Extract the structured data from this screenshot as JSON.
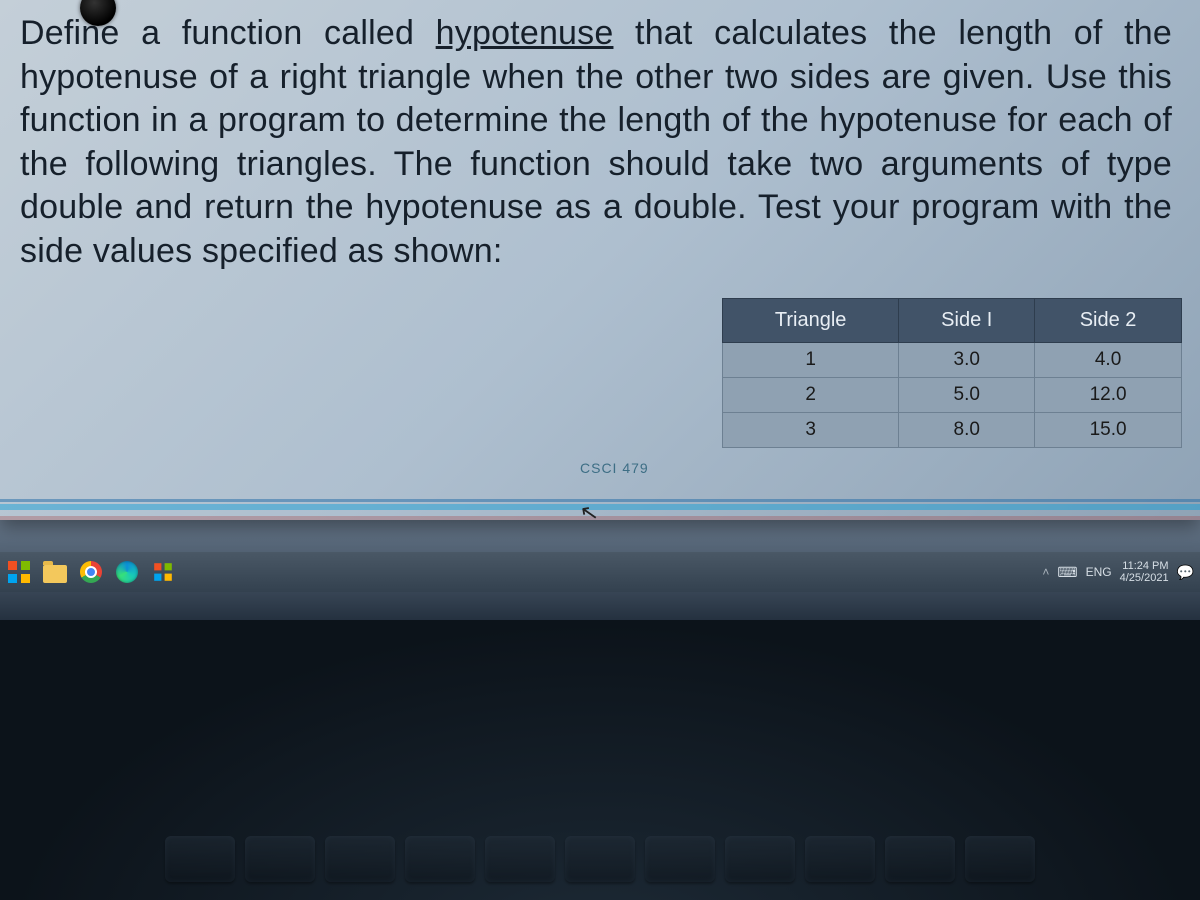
{
  "problem": {
    "prefix": "Define a function called ",
    "keyword": "hypotenuse",
    "rest": " that calculates the length of the hypotenuse of a right triangle when the other two sides are given. Use this function in a program to determine the length of the hypotenuse for each of the following triangles. The function should take two arguments of type double and return the hypotenuse as a double. Test your program with the side values specified as shown:"
  },
  "course_tag": "CSCI 479",
  "table": {
    "headers": [
      "Triangle",
      "Side I",
      "Side 2"
    ],
    "rows": [
      [
        "1",
        "3.0",
        "4.0"
      ],
      [
        "2",
        "5.0",
        "12.0"
      ],
      [
        "3",
        "8.0",
        "15.0"
      ]
    ]
  },
  "taskbar": {
    "lang": "ENG",
    "time": "11:24 PM",
    "date": "4/25/2021",
    "chevron": "˄"
  }
}
